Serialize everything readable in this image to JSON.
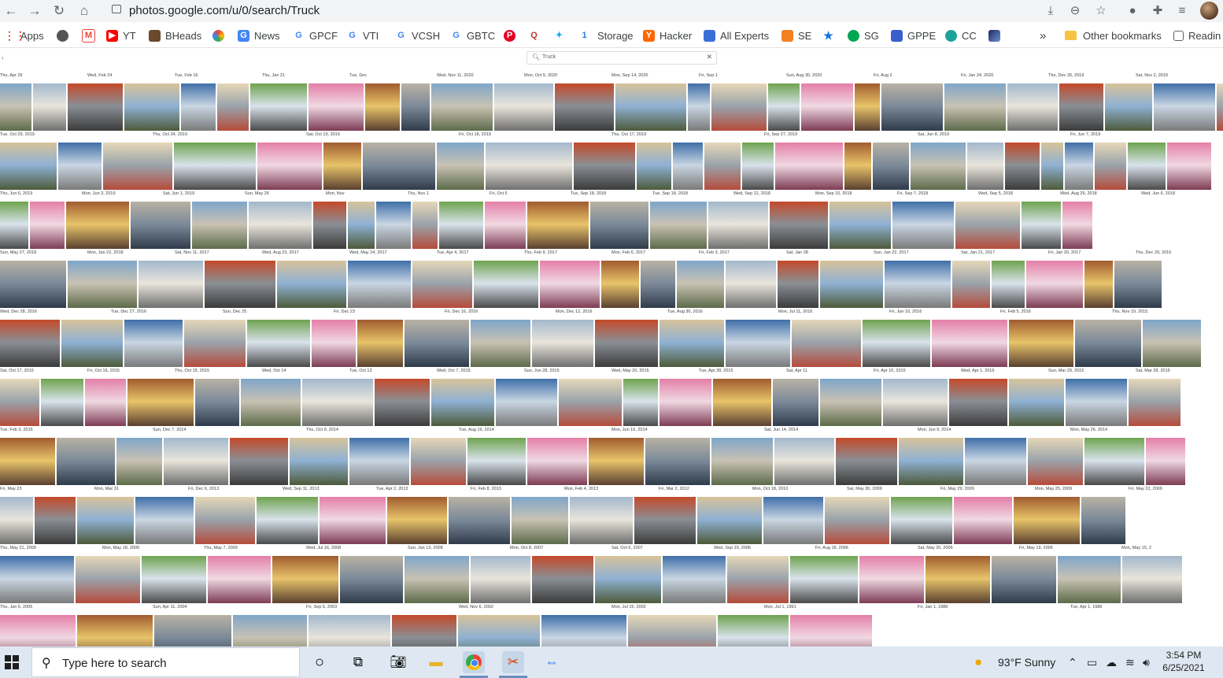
{
  "browser": {
    "url": "photos.google.com/u/0/search/Truck",
    "icons": [
      "back-arrow",
      "forward-arrow",
      "reload",
      "home",
      "lock",
      "download",
      "zoom",
      "star",
      "chat",
      "extensions",
      "media",
      "profile"
    ]
  },
  "bookmarks": {
    "items": [
      {
        "label": "Apps",
        "color": "#ea4335"
      },
      {
        "label": "",
        "color": "#555555"
      },
      {
        "label": "",
        "color": "#ea4335"
      },
      {
        "label": "YT",
        "color": "#ff0000"
      },
      {
        "label": "BHeads",
        "color": "#6b4a2b"
      },
      {
        "label": "",
        "color": "#34a853"
      },
      {
        "label": "News",
        "color": "#4285f4"
      },
      {
        "label": "GPCF",
        "color": "#4285f4"
      },
      {
        "label": "VTI",
        "color": "#4285f4"
      },
      {
        "label": "VCSH",
        "color": "#4285f4"
      },
      {
        "label": "GBTC",
        "color": "#4285f4"
      },
      {
        "label": "",
        "color": "#e60023"
      },
      {
        "label": "",
        "color": "#c0392b"
      },
      {
        "label": "",
        "color": "#1da1f2"
      },
      {
        "label": "",
        "color": "#2b7cd3"
      },
      {
        "label": "Storage",
        "color": "#2b7cd3"
      },
      {
        "label": "Hacker",
        "color": "#ff6600"
      },
      {
        "label": "All Experts",
        "color": "#3b6fd8"
      },
      {
        "label": "SE",
        "color": "#f48024"
      },
      {
        "label": "",
        "color": "#1a73e8"
      },
      {
        "label": "SG",
        "color": "#00a651"
      },
      {
        "label": "GPPE",
        "color": "#3a5fcd"
      },
      {
        "label": "CC",
        "color": "#1aa39a"
      },
      {
        "label": "",
        "color": "#1c2b5a"
      }
    ],
    "overflow": "»",
    "other": "Other bookmarks",
    "reading": "Readin"
  },
  "search": {
    "query": "Truck"
  },
  "photo_rows": [
    {
      "dates": [
        "Thu, Apr 29",
        "Wed, Feb 24",
        "Tue, Feb 16",
        "Thu, Jan 21",
        "Tue, Dec",
        "Wed, Nov 11, 2020",
        "Mon, Oct 5, 2020",
        "Mon, Sep 14, 2020",
        "Fri, Sep 1",
        "Sun, Aug 30, 2020",
        "Fri, Aug 2",
        "Fri, Jan 24, 2020",
        "Thu, Dec 26, 2019",
        "Sat, Nov 2, 2019"
      ]
    },
    {
      "dates": [
        "Tue, Oct 29, 2019",
        "Thu, Oct 24, 2019",
        "Sat, Oct 19, 2019",
        "Fri, Oct 18, 2019",
        "Thu, Oct 17, 2019",
        "Fri, Sep 27, 2019",
        "Sat, Jun 8, 2019",
        "Fri, Jun 7, 2019"
      ]
    },
    {
      "dates": [
        "Thu, Jun 6, 2019",
        "Mon, Jun 3, 2019",
        "Sat, Jun 1, 2019",
        "Sun, May 26",
        "Mon, Nov",
        "Thu, Nov 1",
        "Fri, Oct 5",
        "Tue, Sep 18, 2018",
        "Tue, Sep 18, 2018",
        "Wed, Sep 12, 2018",
        "Mon, Sep 10, 2018",
        "Fri, Sep 7, 2018",
        "Wed, Sep 5, 2018",
        "Wed, Aug 29, 2018",
        "Wed, Jun 6, 2018"
      ]
    },
    {
      "dates": [
        "Sun, May 27, 2018",
        "Mon, Jan 22, 2018",
        "Sat, Nov 11, 2017",
        "Wed, Aug 23, 2017",
        "Wed, May 24, 2017",
        "Tue, Apr 4, 2017",
        "Thu, Feb 9, 2017",
        "Mon, Feb 6, 2017",
        "Fri, Feb 3, 2017",
        "Sat, Jan 28",
        "Sun, Jan 22, 2017",
        "Sat, Jan 21, 2017",
        "Fri, Jan 20, 2017",
        "Thu, Dec 29, 2016"
      ]
    },
    {
      "dates": [
        "Wed, Dec 28, 2016",
        "Tue, Dec 27, 2016",
        "Sun, Dec 25",
        "Fri, Dec 23",
        "Fri, Dec 16, 2016",
        "Mon, Dec 12, 2016",
        "Tue, Aug 30, 2016",
        "Mon, Jul 11, 2016",
        "Fri, Jun 10, 2016",
        "Fri, Feb 5, 2016",
        "Thu, Nov 19, 2015"
      ]
    },
    {
      "dates": [
        "Sat, Oct 17, 2015",
        "Fri, Oct 16, 2015",
        "Thu, Oct 15, 2015",
        "Wed, Oct 14",
        "Tue, Oct 13",
        "Wed, Oct 7, 2015",
        "Sun, Jun 28, 2015",
        "Wed, May 20, 2015",
        "Tue, Apr 28, 2015",
        "Sat, Apr 11",
        "Fri, Apr 10, 2015",
        "Wed, Apr 1, 2015",
        "Sun, Mar 29, 2015",
        "Sat, Mar 28, 2015"
      ]
    },
    {
      "dates": [
        "Tue, Feb 3, 2015",
        "Sun, Dec 7, 2014",
        "Thu, Oct 9, 2014",
        "Tue, Aug 19, 2014",
        "Mon, Jun 16, 2014",
        "Sat, Jun 14, 2014",
        "Mon, Jun 9, 2014",
        "Mon, May 26, 2014"
      ]
    },
    {
      "dates": [
        "Fri, May 23",
        "Mon, Mar 31",
        "Fri, Dec 6, 2013",
        "Wed, Sep 11, 2013",
        "Tue, Apr 2, 2013",
        "Fri, Feb 8, 2013",
        "Mon, Feb 4, 2013",
        "Fri, Mar 2, 2012",
        "Mon, Oct 18, 2010",
        "Sat, May 30, 2009",
        "Fri, May 29, 2009",
        "Mon, May 25, 2009",
        "Fri, May 22, 2009"
      ]
    },
    {
      "dates": [
        "Thu, May 21, 2009",
        "Mon, May 18, 2009",
        "Thu, May 7, 2009",
        "Wed, Jul 16, 2008",
        "Sun, Jan 13, 2008",
        "Mon, Oct 8, 2007",
        "Sat, Oct 6, 2007",
        "Wed, Sep 19, 2006",
        "Fri, Aug 18, 2006",
        "Sat, May 20, 2006",
        "Fri, May 19, 2006",
        "Mon, May 15, 2"
      ]
    },
    {
      "dates": [
        "Thu, Jan 6, 2005",
        "Sun, Apr 11, 2004",
        "Fri, Sep 5, 2003",
        "Wed, Nov 6, 2002",
        "Mon, Jul 15, 2002",
        "Mon, Jul 1, 1991",
        "Fri, Jan 1, 1988",
        "Tue, Apr 1, 1986"
      ]
    }
  ],
  "taskbar": {
    "search_placeholder": "Type here to search",
    "weather": "93°F  Sunny",
    "time": "3:54 PM",
    "date": "6/25/2021"
  }
}
